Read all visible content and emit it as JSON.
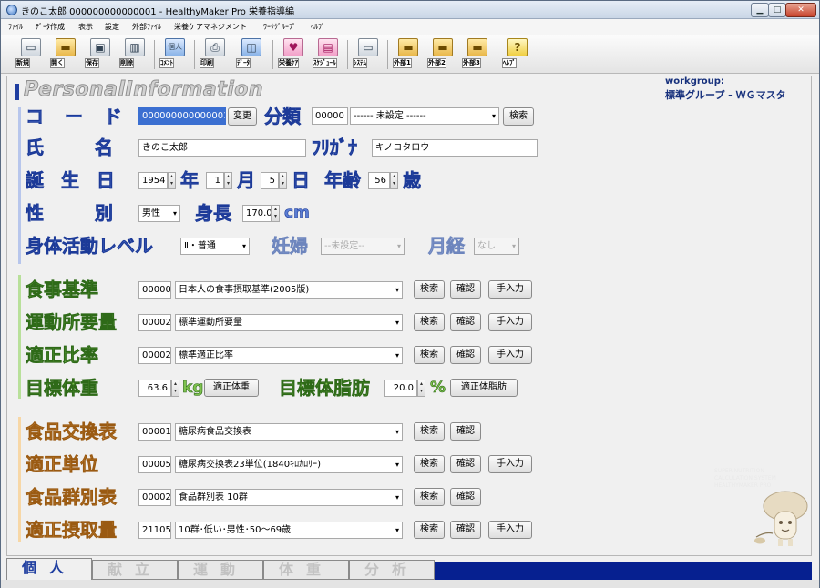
{
  "window": {
    "title": "きのこ太郎 000000000000001 - HealthyMaker Pro 栄養指導編",
    "min": "▁",
    "max": "□",
    "close": "✕"
  },
  "menu": [
    "ﾌｧｲﾙ",
    "ﾃﾞｰﾀ作成",
    "表示",
    "設定",
    "外部ﾌｧｲﾙ",
    "栄養ケアマネジメント",
    "ﾜｰｸｸﾞﾙｰﾌﾟ",
    "ﾍﾙﾌﾟ"
  ],
  "toolbar": [
    {
      "label": "新規",
      "icon": "new-document-icon",
      "glyph": "▭"
    },
    {
      "label": "開く",
      "icon": "open-folder-icon",
      "glyph": "▬"
    },
    {
      "label": "保存",
      "icon": "save-icon",
      "glyph": "▣"
    },
    {
      "label": "削除",
      "icon": "trash-icon",
      "glyph": "▥"
    },
    {
      "label": "ｺﾒﾝﾄ",
      "icon": "comment-icon",
      "glyph": "個人"
    },
    {
      "label": "印刷",
      "icon": "printer-icon",
      "glyph": "⎙"
    },
    {
      "label": "ﾃﾞｰﾀ",
      "icon": "database-icon",
      "glyph": "◫"
    },
    {
      "label": "栄養ｹｱ",
      "icon": "heart-icon",
      "glyph": "♥"
    },
    {
      "label": "ｽｹｼﾞｭｰﾙ",
      "icon": "calendar-icon",
      "glyph": "▤"
    },
    {
      "label": "ｼｽﾃﾑ",
      "icon": "computer-icon",
      "glyph": "▭"
    },
    {
      "label": "外部1",
      "icon": "external-folder-1-icon",
      "glyph": "▬"
    },
    {
      "label": "外部2",
      "icon": "external-folder-2-icon",
      "glyph": "▬"
    },
    {
      "label": "外部3",
      "icon": "external-folder-3-icon",
      "glyph": "▬"
    },
    {
      "label": "ﾍﾙﾌﾟ",
      "icon": "help-icon",
      "glyph": "?"
    }
  ],
  "header": {
    "title": "PersonalInformation",
    "workgroup_label": "workgroup:",
    "workgroup_value": "標準グループ - ＷＧマスタ"
  },
  "fields": {
    "code": {
      "label": "コ ー ド",
      "value": "000000000000001",
      "change_button": "変更"
    },
    "category": {
      "label": "分類",
      "code": "00000",
      "selected": "------ 未設定 ------",
      "search_button": "検索"
    },
    "name": {
      "label": "氏　名",
      "value": "きのこ太郎"
    },
    "furigana": {
      "label": "ﾌﾘｶﾞﾅ",
      "value": "キノコタロウ"
    },
    "birthdate": {
      "label": "誕 生 日",
      "year": "1954",
      "year_unit": "年",
      "month": "1",
      "month_unit": "月",
      "day": "5",
      "day_unit": "日"
    },
    "age": {
      "label": "年齢",
      "value": "56",
      "unit": "歳"
    },
    "sex": {
      "label": "性　別",
      "selected": "男性"
    },
    "height": {
      "label": "身長",
      "value": "170.0",
      "unit": "cm"
    },
    "activity": {
      "label": "身体活動レベル",
      "selected": "Ⅱ・普通"
    },
    "pregnancy": {
      "label": "妊婦",
      "selected": "--未設定--"
    },
    "menstruation": {
      "label": "月経",
      "selected": "なし"
    },
    "diet_standard": {
      "label": "食事基準",
      "code": "00000",
      "selected": "日本人の食事摂取基準(2005版)"
    },
    "exercise": {
      "label": "運動所要量",
      "code": "00002",
      "selected": "標準運動所要量"
    },
    "ratio": {
      "label": "適正比率",
      "code": "00002",
      "selected": "標準適正比率"
    },
    "target_weight": {
      "label": "目標体重",
      "value": "63.6",
      "unit": "kg",
      "button": "適正体重"
    },
    "target_fat": {
      "label": "目標体脂肪",
      "value": "20.0",
      "unit": "%",
      "button": "適正体脂肪"
    },
    "exchange_table": {
      "label": "食品交換表",
      "code": "00001",
      "selected": "糖尿病食品交換表"
    },
    "unit_amount": {
      "label": "適正単位",
      "code": "00005",
      "selected": "糖尿病交換表23単位(1840ｷﾛｶﾛﾘｰ)"
    },
    "group_table": {
      "label": "食品群別表",
      "code": "00002",
      "selected": "食品群別表 10群"
    },
    "intake": {
      "label": "適正摂取量",
      "code": "21105",
      "selected": "10群･低い･男性･50～69歳"
    }
  },
  "buttons": {
    "search": "検索",
    "confirm": "確認",
    "manual": "手入力"
  },
  "tabs": [
    "個人",
    "献立",
    "運動",
    "体重",
    "分析"
  ],
  "watermark": [
    "SUPER NUTRITION",
    "CALCULATION SYSTEM",
    "HEALTHYMAKER PRO"
  ],
  "colors": {
    "blue_section": "#5b7dd3",
    "green_section": "#7ec24e",
    "orange_section": "#f0b66a",
    "tab_fill": "#062090"
  }
}
